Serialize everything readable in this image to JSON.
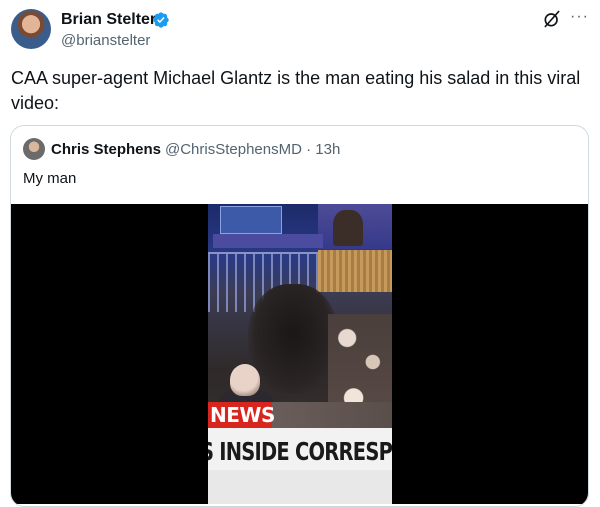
{
  "tweet": {
    "author_name": "Brian Stelter",
    "author_handle": "@brianstelter",
    "text": "CAA super-agent Michael Glantz is the man eating his salad in this viral video:",
    "more_label": "···"
  },
  "quote": {
    "author_name": "Chris Stephens",
    "author_handle": "@ChrisStephensMD",
    "separator": "·",
    "time": "13h",
    "text": "My man"
  },
  "video": {
    "news_label": "NEWS",
    "lower_third": "S INSIDE CORRESPON"
  },
  "colors": {
    "verified": "#1d9bf0",
    "secondary_text": "#536471",
    "news_red": "#d7261e"
  },
  "icons": [
    "verified-badge-icon",
    "grok-icon",
    "more-options-icon"
  ]
}
